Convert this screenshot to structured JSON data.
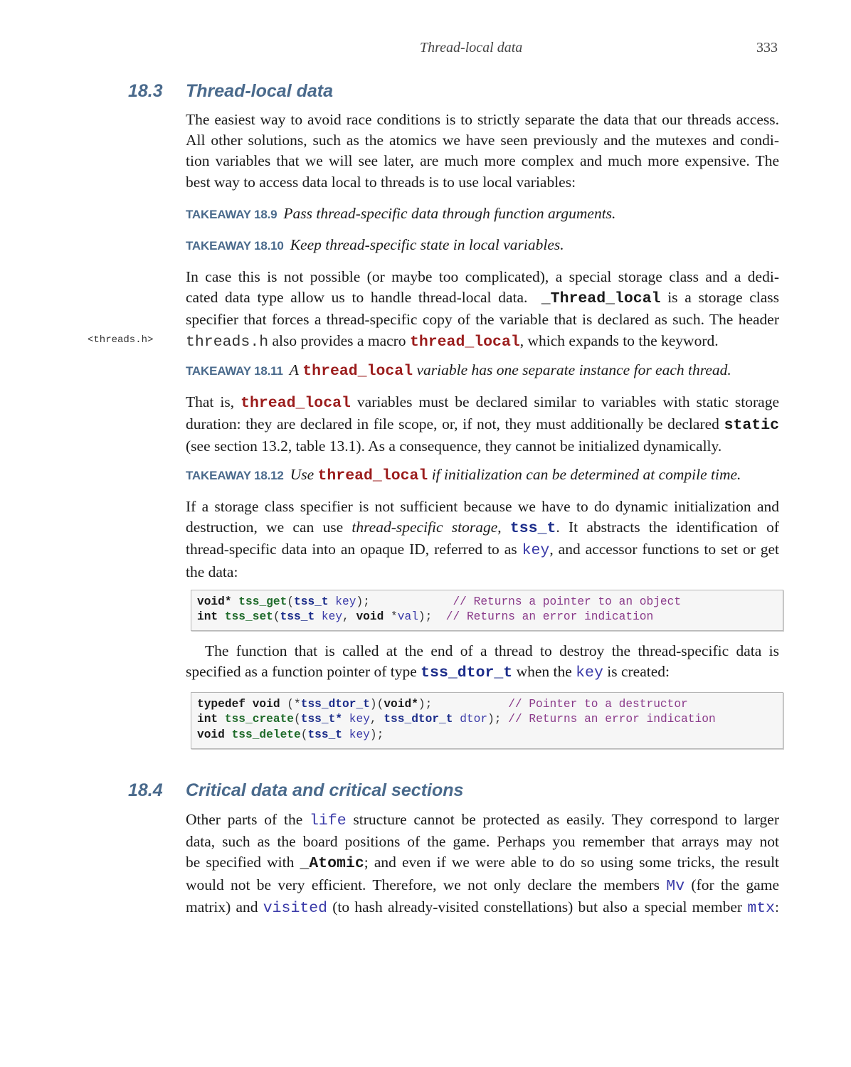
{
  "running_head": {
    "title": "Thread-local data",
    "page": "333"
  },
  "section_18_3": {
    "number": "18.3",
    "title": "Thread-local data",
    "intro_lines": [
      "The easiest way to avoid race conditions is to strictly separate the data that our threads access.",
      "All other solutions, such as the atomics we have seen previously and the mutexes and condi-",
      "tion variables that we will see later, are much more complex and much more expensive. The",
      "best way to access data local to threads is to use local variables:"
    ],
    "takeaway_9": {
      "label": "TAKEAWAY 18.9",
      "text": "Pass thread-specific data through function arguments."
    },
    "takeaway_10": {
      "label": "TAKEAWAY 18.10",
      "text": "Keep thread-specific state in local variables."
    },
    "para2": {
      "l1": "In case this is not possible (or maybe too complicated), a special storage class and a dedi-",
      "l2a": "cated data type allow us to handle thread-local data.",
      "l2_code": "_Thread_local",
      "l2b": "is a storage class",
      "l3": "specifier that forces a thread-specific copy of the variable that is declared as such. The header",
      "l4_code": "threads.h",
      "l4a": "also provides a macro",
      "l4_macro": "thread_local",
      "l4b": ", which expands to the keyword."
    },
    "margin_note": "<threads.h>",
    "takeaway_11": {
      "label": "TAKEAWAY 18.11",
      "pre": "A",
      "code": "thread_local",
      "post": "variable has one separate instance for each thread."
    },
    "para3": {
      "l1a": "That is,",
      "l1_code": "thread_local",
      "l1b": "variables must be declared similar to variables with static storage",
      "l2a": "duration: they are declared in file scope, or, if not, they must additionally be declared",
      "l2_code": "static",
      "l3": "(see section 13.2, table 13.1). As a consequence, they cannot be initialized dynamically."
    },
    "takeaway_12": {
      "label": "TAKEAWAY 18.12",
      "pre": "Use",
      "code": "thread_local",
      "post": "if initialization can be determined at compile time."
    },
    "para4": {
      "l1": "If a storage class specifier is not sufficient because we have to do dynamic initialization and",
      "l2a": "destruction, we can use",
      "l2_em": "thread-specific storage",
      "l2_comma": ",",
      "l2_code": "tss_t",
      "l2b": ". It abstracts the identification of",
      "l3a": "thread-specific data into an opaque ID, referred to as",
      "l3_code": "key",
      "l3b": ", and accessor functions to set or get",
      "l4": "the data:"
    },
    "code1": {
      "line1": {
        "ret": "void",
        "star": "*",
        "fn": "tss_get",
        "open": "(",
        "ty": "tss_t",
        "arg": " key",
        "close": ");",
        "pad": "            ",
        "comment": "// Returns a pointer to an object"
      },
      "line2": {
        "ret": "int",
        "fn": "tss_set",
        "open": "(",
        "ty": "tss_t",
        "arg": " key",
        "sep": ", ",
        "kw2": "void",
        "star": " *",
        "arg2": "val",
        "close": ");",
        "pad": "  ",
        "comment": "// Returns an error indication"
      }
    },
    "para5": {
      "l1": "The function that is called at the end of a thread to destroy the thread-specific data is",
      "l2a": "specified as a function pointer of type",
      "l2_code": "tss_dtor_t",
      "l2b": "when the",
      "l2_code2": "key",
      "l2c": "is created:"
    },
    "code2": {
      "line1": {
        "kw1": "typedef",
        "kw2": "void",
        "open": " (*",
        "ty": "tss_dtor_t",
        "mid": ")(",
        "kw3": "void",
        "star": "*",
        "close": ");",
        "pad": "           ",
        "comment": "// Pointer to a destructor"
      },
      "line2": {
        "ret": "int",
        "fn": "tss_create",
        "open": "(",
        "ty": "tss_t",
        "star": "*",
        "arg": " key",
        "sep": ", ",
        "ty2": "tss_dtor_t",
        "arg2": " dtor",
        "close": ");",
        "pad": " ",
        "comment": "// Returns an error indication"
      },
      "line3": {
        "ret": "void",
        "fn": "tss_delete",
        "open": "(",
        "ty": "tss_t",
        "arg": " key",
        "close": ");"
      }
    }
  },
  "section_18_4": {
    "number": "18.4",
    "title": "Critical data and critical sections",
    "para": {
      "l1a": "Other parts of the",
      "l1_code": "life",
      "l1b": "structure cannot be protected as easily. They correspond to larger",
      "l2": "data, such as the board positions of the game. Perhaps you remember that arrays may not",
      "l3a": "be specified with",
      "l3_code": "_Atomic",
      "l3b": "; and even if we were able to do so using some tricks, the result",
      "l4a": "would not be very efficient. Therefore, we not only declare the members",
      "l4_code": "Mv",
      "l4b": "(for the game",
      "l5a": "matrix) and",
      "l5_code": "visited",
      "l5b": "(to hash already-visited constellations) but also a special member",
      "l5_code2": "mtx",
      "l5c": ":"
    }
  }
}
